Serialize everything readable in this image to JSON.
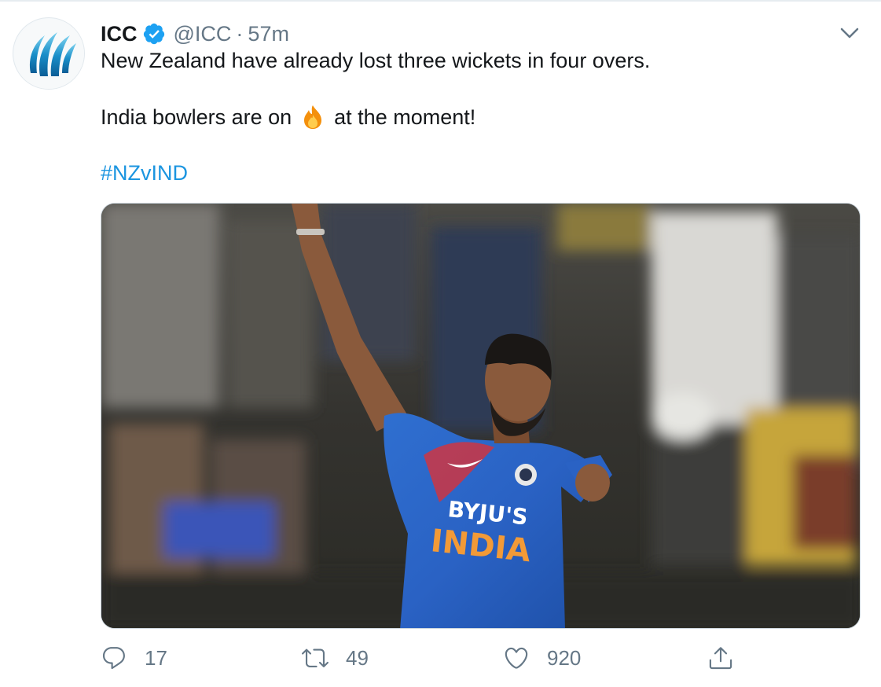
{
  "tweet": {
    "author_name": "ICC",
    "handle": "@ICC",
    "separator": "·",
    "time": "57m",
    "line1": "New Zealand have already lost three wickets in four overs.",
    "line2_before": "India bowlers are on",
    "line2_after": "at the moment!",
    "hashtag": "#NZvIND",
    "media": {
      "sponsor": "BYJU'S",
      "team": "INDIA"
    }
  },
  "actions": {
    "replies": "17",
    "retweets": "49",
    "likes": "920"
  },
  "icons": {
    "verified": "verified-badge-icon",
    "caret": "chevron-down-icon",
    "reply": "reply-icon",
    "retweet": "retweet-icon",
    "like": "heart-icon",
    "share": "share-icon",
    "emoji": "fire-emoji"
  },
  "colors": {
    "link": "#1b95e0",
    "muted": "#657786",
    "text": "#14171a"
  }
}
